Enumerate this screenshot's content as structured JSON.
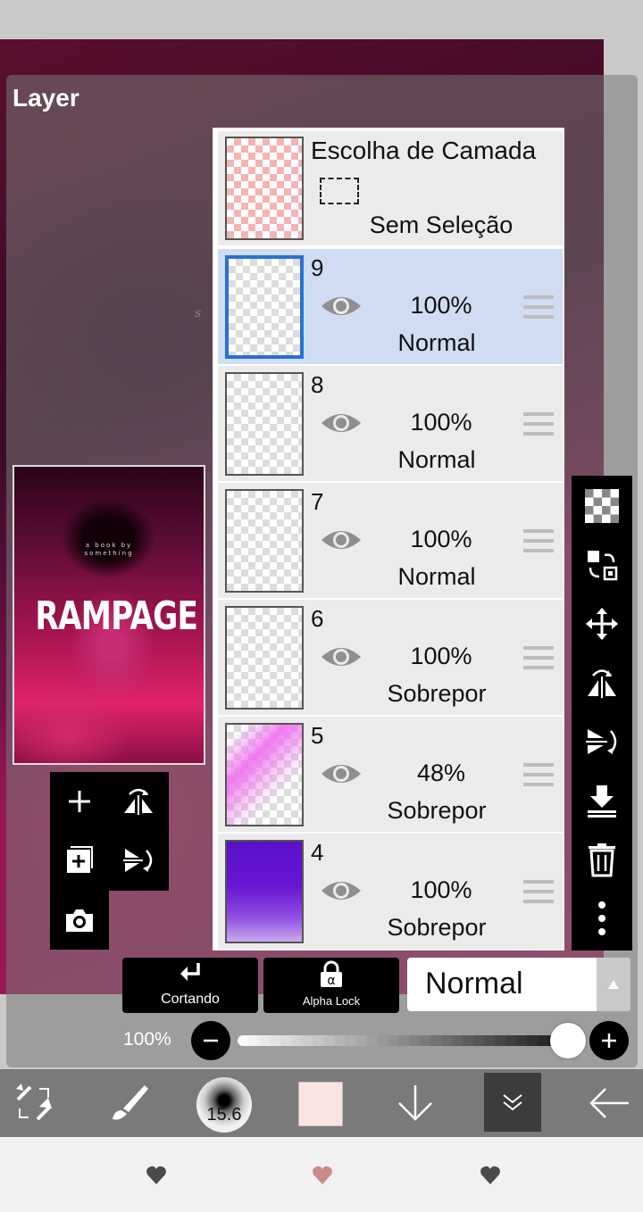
{
  "panel": {
    "title": "Layer"
  },
  "canvas": {
    "mark": "s"
  },
  "preview": {
    "small_line_1": "a book by",
    "small_line_2": "something",
    "title": "RAMPAGE"
  },
  "selection_layer": {
    "title": "Escolha de Camada",
    "status": "Sem Seleção"
  },
  "layers": [
    {
      "number": "9",
      "opacity": "100%",
      "mode": "Normal",
      "selected": true,
      "thumb": "empty"
    },
    {
      "number": "8",
      "opacity": "100%",
      "mode": "Normal",
      "selected": false,
      "thumb": "text"
    },
    {
      "number": "7",
      "opacity": "100%",
      "mode": "Normal",
      "selected": false,
      "thumb": "empty"
    },
    {
      "number": "6",
      "opacity": "100%",
      "mode": "Sobrepor",
      "selected": false,
      "thumb": "empty"
    },
    {
      "number": "5",
      "opacity": "48%",
      "mode": "Sobrepor",
      "selected": false,
      "thumb": "pink-gradient"
    },
    {
      "number": "4",
      "opacity": "100%",
      "mode": "Sobrepor",
      "selected": false,
      "thumb": "purple-gradient"
    }
  ],
  "controls": {
    "clipping_label": "Cortando",
    "alpha_lock_label": "Alpha Lock",
    "blend_mode": "Normal",
    "opacity_label": "100%",
    "opacity_value": 1.0
  },
  "toolbar": {
    "brush_size": "15.6",
    "color": "#f9e3e3"
  },
  "colors": {
    "selected_row": "#cfdcf1",
    "row": "#ebebeb",
    "selection_border": "#2a6fd6",
    "heart_dark": "#4a4a4a",
    "heart_pink": "#c98a8a"
  }
}
